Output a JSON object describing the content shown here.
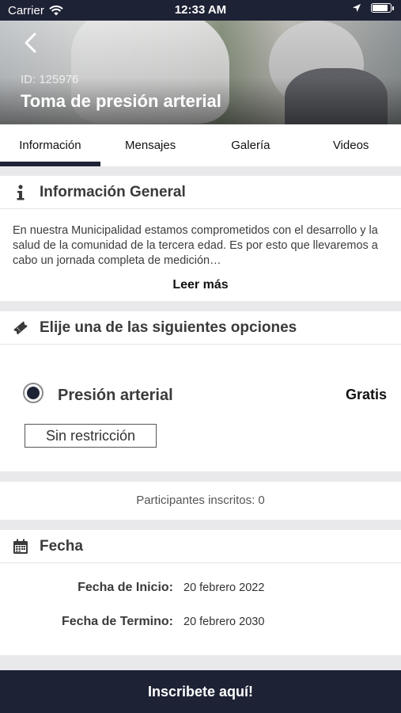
{
  "status_bar": {
    "carrier": "Carrier",
    "time": "12:33 AM",
    "battery_level": 0.9
  },
  "hero": {
    "id_text": "ID: 125976",
    "title": "Toma de presión arterial",
    "back_icon": "chevron-left-icon"
  },
  "tabs": [
    {
      "label": "Información",
      "active": true
    },
    {
      "label": "Mensajes",
      "active": false
    },
    {
      "label": "Galería",
      "active": false
    },
    {
      "label": "Videos",
      "active": false
    }
  ],
  "general_info": {
    "icon": "info-icon",
    "title": "Información General",
    "text": "En nuestra Municipalidad estamos comprometidos con el desarrollo y la salud de la comunidad de la tercera edad. Es por esto que llevaremos a cabo un jornada completa de medición…",
    "read_more": "Leer más"
  },
  "options": {
    "icon": "ticket-icon",
    "title": "Elije una de las siguientes opciones",
    "items": [
      {
        "label": "Presión arterial",
        "price": "Gratis",
        "selected": true,
        "restriction": "Sin restricción"
      }
    ]
  },
  "participants": {
    "text": "Participantes inscritos: 0"
  },
  "dates": {
    "icon": "calendar-icon",
    "title": "Fecha",
    "start_label": "Fecha de Inicio:",
    "start_value": "20 febrero 2022",
    "end_label": "Fecha de Termino:",
    "end_value": "20 febrero 2030"
  },
  "cta": {
    "label": "Inscribete aquí!"
  },
  "colors": {
    "primary": "#1e2235",
    "background": "#e9e9ec"
  }
}
